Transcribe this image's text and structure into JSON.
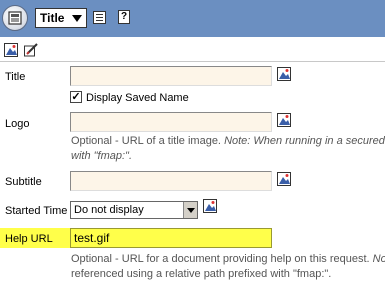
{
  "toolbar": {
    "title_dropdown": "Title",
    "icons": [
      "app-menu-icon",
      "list-icon",
      "help-icon"
    ],
    "help_glyph": "?"
  },
  "subtoolbar": {
    "icons": [
      "image-picker-icon",
      "edit-icon"
    ]
  },
  "form": {
    "title": {
      "label": "Title",
      "value": ""
    },
    "display_saved_name": {
      "label": "Display Saved Name",
      "checked": true,
      "mark": "✓"
    },
    "logo": {
      "label": "Logo",
      "value": "",
      "hint_plain": "Optional - URL of a title image. ",
      "hint_note": "Note: When running in a secured e",
      "hint_line2": "with \"fmap:\"."
    },
    "subtitle": {
      "label": "Subtitle",
      "value": ""
    },
    "started_time": {
      "label": "Started Time",
      "selected": "Do not display"
    },
    "help_url": {
      "label": "Help URL",
      "value": "test.gif",
      "hint_plain": "Optional - URL for a document providing help on this request. ",
      "hint_note": "Note",
      "hint_line2": "referenced using a relative path prefixed with \"fmap:\"."
    }
  },
  "colors": {
    "toolbar": "#6b8fc1",
    "field_bg": "#fdf5e8",
    "highlight": "#ffff4a"
  }
}
